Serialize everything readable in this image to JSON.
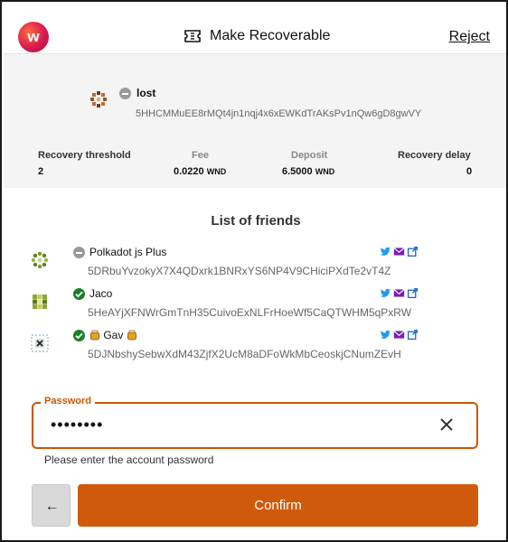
{
  "header": {
    "title": "Make Recoverable",
    "reject_label": "Reject",
    "logo_letter": "w"
  },
  "lost_account": {
    "name": "lost",
    "address": "5HHCMMuEE8rMQt4jn1nqj4x6xEWKdTrAKsPv1nQw6gD8gwVY"
  },
  "stats": {
    "recovery_threshold_label": "Recovery threshold",
    "recovery_threshold_value": "2",
    "fee_label": "Fee",
    "fee_value": "0.0220",
    "fee_unit": "WND",
    "deposit_label": "Deposit",
    "deposit_value": "6.5000",
    "deposit_unit": "WND",
    "recovery_delay_label": "Recovery delay",
    "recovery_delay_value": "0"
  },
  "friends": {
    "title": "List of friends",
    "items": [
      {
        "name": "Polkadot js Plus",
        "address": "5DRbuYvzokyX7X4QDxrk1BNRxYS6NP4V9CHiciPXdTe2vT4Z",
        "status": "unverified"
      },
      {
        "name": "Jaco",
        "address": "5HeAYjXFNWrGmTnH35CuivoExNLFrHoeWf5CaQTWHM5qPxRW",
        "status": "verified"
      },
      {
        "name": "Gav",
        "address": "5DJNbshySebwXdM43ZjfX2UcM8aDFoWkMbCeoskjCNumZEvH",
        "status": "verified"
      }
    ]
  },
  "password": {
    "label": "Password",
    "value": "••••••••",
    "hint": "Please enter the account password"
  },
  "buttons": {
    "back_glyph": "←",
    "confirm_label": "Confirm"
  },
  "colors": {
    "accent": "#cc5500",
    "confirm_bg": "#d05a0b",
    "verified": "#1d7f2a",
    "twitter": "#1d9bf0",
    "email": "#7a1fb3",
    "link": "#1769c8"
  }
}
